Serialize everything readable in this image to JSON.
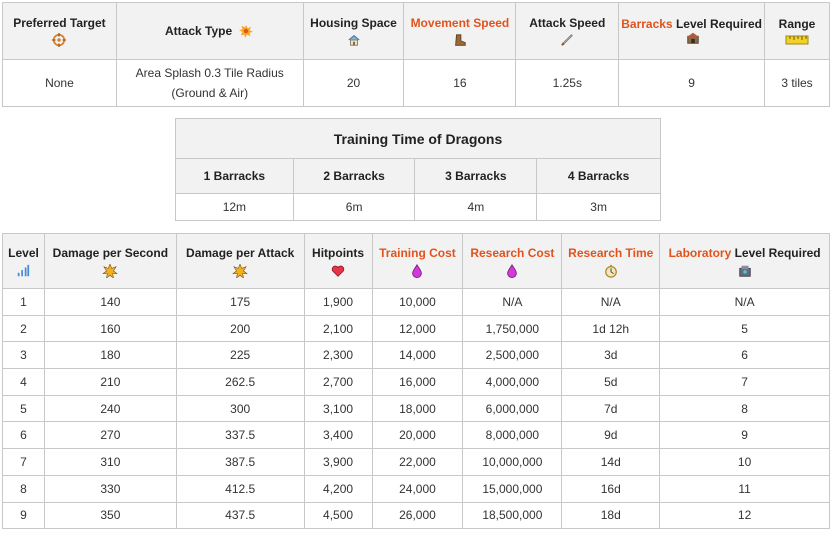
{
  "stats": {
    "headers": {
      "preferred_target": "Preferred Target",
      "attack_type": "Attack Type",
      "housing_space": "Housing Space",
      "movement_speed": "Movement Speed",
      "attack_speed": "Attack Speed",
      "barracks_word": "Barracks",
      "barracks_rest": "Level Required",
      "range": "Range"
    },
    "values": {
      "preferred_target": "None",
      "attack_type_line1": "Area Splash 0.3 Tile Radius",
      "attack_type_line2": "(Ground & Air)",
      "housing_space": "20",
      "movement_speed": "16",
      "attack_speed": "1.25s",
      "barracks_level": "9",
      "range": "3 tiles"
    }
  },
  "training": {
    "caption": "Training Time of Dragons",
    "columns": [
      "1 Barracks",
      "2 Barracks",
      "3 Barracks",
      "4 Barracks"
    ],
    "values": [
      "12m",
      "6m",
      "4m",
      "3m"
    ]
  },
  "levels": {
    "headers": {
      "level": "Level",
      "dps": "Damage per Second",
      "dpa": "Damage per Attack",
      "hitpoints": "Hitpoints",
      "training_cost": "Training Cost",
      "research_cost": "Research Cost",
      "research_time": "Research Time",
      "laboratory_word": "Laboratory",
      "laboratory_rest": "Level Required"
    },
    "rows": [
      [
        "1",
        "140",
        "175",
        "1,900",
        "10,000",
        "N/A",
        "N/A",
        "N/A"
      ],
      [
        "2",
        "160",
        "200",
        "2,100",
        "12,000",
        "1,750,000",
        "1d 12h",
        "5"
      ],
      [
        "3",
        "180",
        "225",
        "2,300",
        "14,000",
        "2,500,000",
        "3d",
        "6"
      ],
      [
        "4",
        "210",
        "262.5",
        "2,700",
        "16,000",
        "4,000,000",
        "5d",
        "7"
      ],
      [
        "5",
        "240",
        "300",
        "3,100",
        "18,000",
        "6,000,000",
        "7d",
        "8"
      ],
      [
        "6",
        "270",
        "337.5",
        "3,400",
        "20,000",
        "8,000,000",
        "9d",
        "9"
      ],
      [
        "7",
        "310",
        "387.5",
        "3,900",
        "22,000",
        "10,000,000",
        "14d",
        "10"
      ],
      [
        "8",
        "330",
        "412.5",
        "4,200",
        "24,000",
        "15,000,000",
        "16d",
        "11"
      ],
      [
        "9",
        "350",
        "437.5",
        "4,500",
        "26,000",
        "18,500,000",
        "18d",
        "12"
      ]
    ]
  },
  "icons": {
    "preferred_target": "target-icon",
    "attack_type": "explosion-icon",
    "housing_space": "house-icon",
    "movement_speed": "boot-icon",
    "attack_speed": "sword-icon",
    "barracks": "barracks-icon",
    "range": "ruler-icon",
    "level": "level-bars-icon",
    "damage": "damage-burst-icon",
    "hitpoints": "heart-icon",
    "elixir": "elixir-drop-icon",
    "clock": "clock-icon",
    "laboratory": "laboratory-icon"
  },
  "colors": {
    "accent": "#e2531c",
    "header_bg": "#f2f2f2",
    "border": "#c8c8c8"
  }
}
